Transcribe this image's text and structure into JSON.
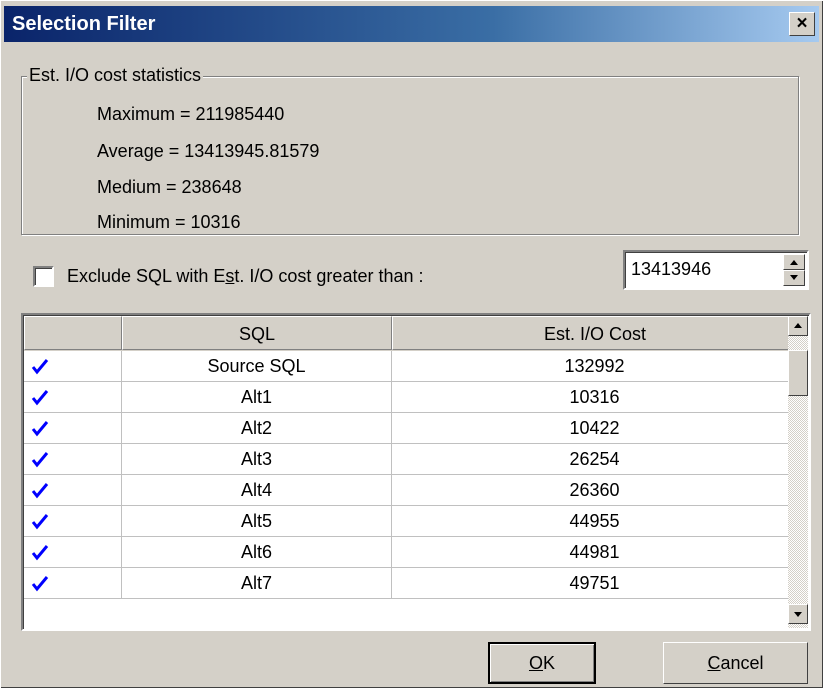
{
  "window": {
    "title": "Selection Filter",
    "close_glyph": "×"
  },
  "stats": {
    "legend": "Est. I/O cost statistics",
    "lines": [
      "Maximum = 211985440",
      "Average = 13413945.81579",
      "Medium = 238648",
      "Minimum = 10316"
    ]
  },
  "exclude": {
    "checked": false,
    "label_pre": "Exclude SQL with E",
    "label_mnemonic": "s",
    "label_post": "t. I/O cost greater than :",
    "value": "13413946"
  },
  "grid": {
    "columns": [
      "",
      "SQL",
      "Est. I/O Cost"
    ],
    "rows": [
      {
        "checked": true,
        "sql": "Source SQL",
        "cost": "132992"
      },
      {
        "checked": true,
        "sql": "Alt1",
        "cost": "10316"
      },
      {
        "checked": true,
        "sql": "Alt2",
        "cost": "10422"
      },
      {
        "checked": true,
        "sql": "Alt3",
        "cost": "26254"
      },
      {
        "checked": true,
        "sql": "Alt4",
        "cost": "26360"
      },
      {
        "checked": true,
        "sql": "Alt5",
        "cost": "44955"
      },
      {
        "checked": true,
        "sql": "Alt6",
        "cost": "44981"
      },
      {
        "checked": true,
        "sql": "Alt7",
        "cost": "49751"
      }
    ]
  },
  "buttons": {
    "ok_mnemonic": "O",
    "ok_rest": "K",
    "cancel_mnemonic": "C",
    "cancel_rest": "ancel"
  },
  "colors": {
    "titlebar_start": "#0a246a",
    "titlebar_end": "#a6caf0",
    "dialog_face": "#d4d0c8",
    "checkmark": "#0000ff"
  }
}
